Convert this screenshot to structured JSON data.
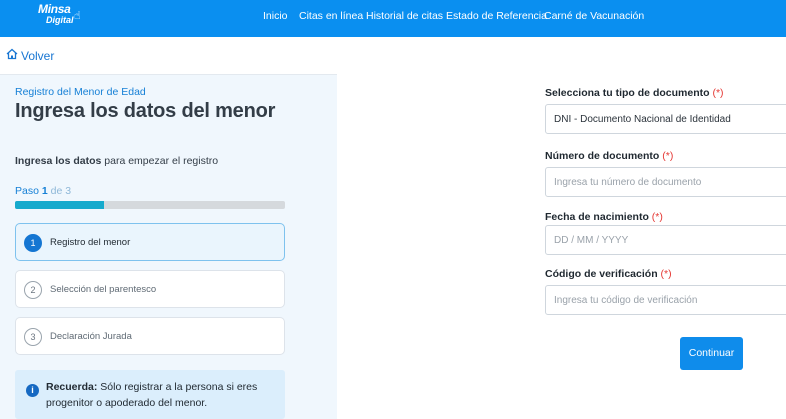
{
  "header": {
    "logo_line1": "Minsa",
    "logo_line2": "Digital",
    "nav": [
      "Inicio",
      "Citas en línea",
      "Historial de citas",
      "Estado de Referencia",
      "Carné de Vacunación"
    ]
  },
  "left": {
    "back_label": "Volver",
    "subtitle": "Registro del Menor de Edad",
    "title": "Ingresa los datos del menor",
    "intro_bold": "Ingresa los datos",
    "intro_rest": " para empezar el registro",
    "step_prefix": "Paso ",
    "step_current": "1",
    "step_suffix": " de 3",
    "progress_fraction": 0.33,
    "steps": [
      {
        "num": "1",
        "label": "Registro del menor",
        "active": true
      },
      {
        "num": "2",
        "label": "Selección del parentesco",
        "active": false
      },
      {
        "num": "3",
        "label": "Declaración Jurada",
        "active": false
      }
    ],
    "notice_bold": "Recuerda:",
    "notice_text": " Sólo registrar a la persona si eres progenitor o apoderado del menor."
  },
  "form": {
    "doc_type_label": "Selecciona tu tipo de documento",
    "doc_type_value": "DNI - Documento Nacional de Identidad",
    "doc_number_label": "Número de documento",
    "doc_number_placeholder": "Ingresa tu número de documento",
    "birth_label": "Fecha de nacimiento",
    "birth_placeholder": "DD / MM / YYYY",
    "code_label": "Código de verificación",
    "code_placeholder": "Ingresa tu código de verificación",
    "required_mark": "(*)",
    "submit_label": "Continuar"
  },
  "colors": {
    "primary": "#0a8ff0",
    "progress": "#16aacd",
    "required": "#e53935"
  }
}
